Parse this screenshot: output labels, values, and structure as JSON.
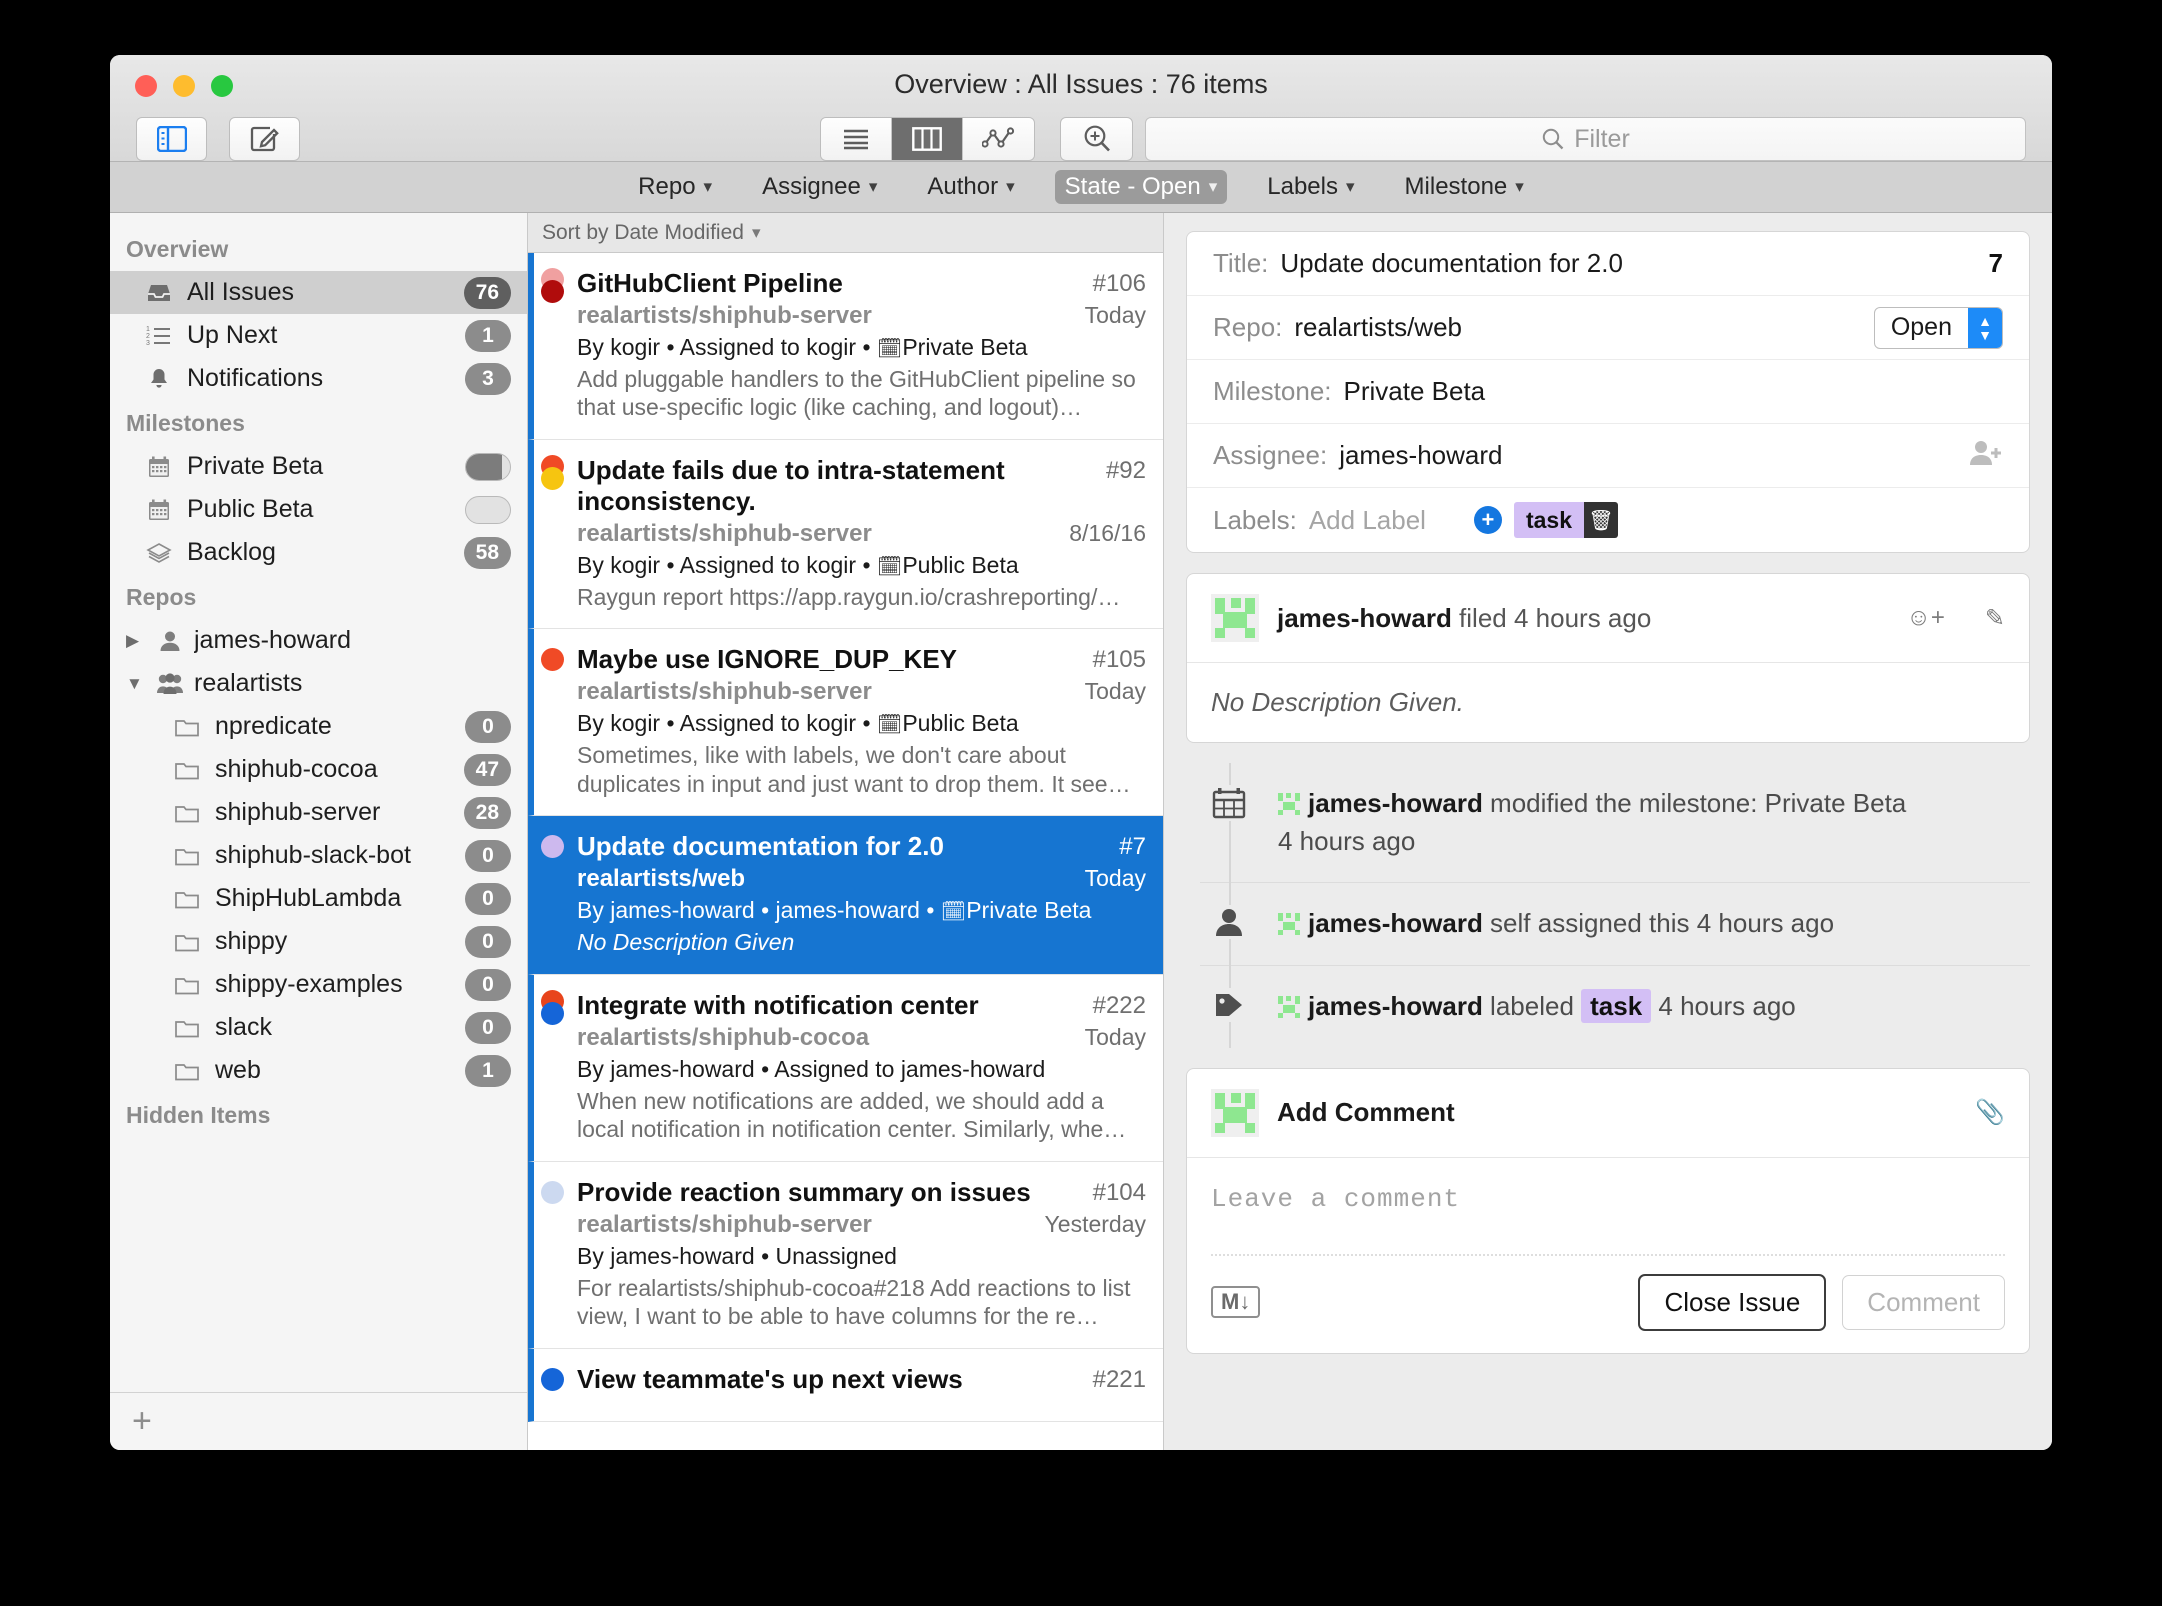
{
  "window": {
    "title": "Overview : All Issues : 76 items"
  },
  "toolbar": {
    "sidebar_toggle": "sidebar-toggle",
    "compose": "compose",
    "view_modes": [
      {
        "name": "list",
        "selected": false
      },
      {
        "name": "columns",
        "selected": true
      },
      {
        "name": "chart",
        "selected": false
      }
    ],
    "zoom": "zoom-in",
    "filter_placeholder": "Filter"
  },
  "filter_bar": [
    {
      "label": "Repo",
      "active": false
    },
    {
      "label": "Assignee",
      "active": false
    },
    {
      "label": "Author",
      "active": false
    },
    {
      "label": "State - Open",
      "active": true
    },
    {
      "label": "Labels",
      "active": false
    },
    {
      "label": "Milestone",
      "active": false
    }
  ],
  "sidebar": {
    "sections": [
      {
        "header": "Overview",
        "items": [
          {
            "label": "All Issues",
            "badge": "76",
            "icon": "inbox-icon",
            "selected": true,
            "badge_style": "dark"
          },
          {
            "label": "Up Next",
            "badge": "1",
            "icon": "numbered-list-icon",
            "selected": false,
            "badge_style": "gray"
          },
          {
            "label": "Notifications",
            "badge": "3",
            "icon": "bell-icon",
            "selected": false,
            "badge_style": "gray"
          }
        ]
      },
      {
        "header": "Milestones",
        "items": [
          {
            "label": "Private Beta",
            "icon": "calendar-icon",
            "progress": 82
          },
          {
            "label": "Public Beta",
            "icon": "calendar-icon",
            "progress": 0
          },
          {
            "label": "Backlog",
            "badge": "58",
            "icon": "stack-icon",
            "badge_style": "gray"
          }
        ]
      }
    ],
    "repos_header": "Repos",
    "owners": [
      {
        "label": "james-howard",
        "icon": "person-icon",
        "expanded": false,
        "repos": []
      },
      {
        "label": "realartists",
        "icon": "people-icon",
        "expanded": true,
        "repos": [
          {
            "label": "npredicate",
            "badge": "0"
          },
          {
            "label": "shiphub-cocoa",
            "badge": "47"
          },
          {
            "label": "shiphub-server",
            "badge": "28"
          },
          {
            "label": "shiphub-slack-bot",
            "badge": "0"
          },
          {
            "label": "ShipHubLambda",
            "badge": "0"
          },
          {
            "label": "shippy",
            "badge": "0"
          },
          {
            "label": "shippy-examples",
            "badge": "0"
          },
          {
            "label": "slack",
            "badge": "0"
          },
          {
            "label": "web",
            "badge": "1"
          }
        ]
      }
    ],
    "hidden_header": "Hidden Items",
    "add_label": "+"
  },
  "list": {
    "sort_label": "Sort by Date Modified",
    "issues": [
      {
        "title": "GitHubClient Pipeline",
        "number": "#106",
        "repo": "realartists/shiphub-server",
        "date": "Today",
        "meta": "By kogir • Assigned to kogir • ",
        "milestone": "Private Beta",
        "desc": "Add pluggable handlers to the GitHubClient pipeline so that use-specific logic (like caching, and logout)…",
        "desc_italic": false,
        "selected": false,
        "dot_top": "#f0a0a0",
        "dot_bottom": "#b00c0c"
      },
      {
        "title": "Update fails due to intra-statement inconsistency.",
        "number": "#92",
        "repo": "realartists/shiphub-server",
        "date": "8/16/16",
        "meta": "By kogir • Assigned to kogir • ",
        "milestone": "Public Beta",
        "desc": "Raygun report https://app.raygun.io/crashreporting/…",
        "desc_italic": false,
        "selected": false,
        "dot_top": "#f04a26",
        "dot_bottom": "#f6c510"
      },
      {
        "title": "Maybe use IGNORE_DUP_KEY",
        "number": "#105",
        "repo": "realartists/shiphub-server",
        "date": "Today",
        "meta": "By kogir • Assigned to kogir • ",
        "milestone": "Public Beta",
        "desc": "Sometimes, like with labels, we don't care about duplicates in input and just want to drop them. It see…",
        "desc_italic": false,
        "selected": false,
        "dot_top": "",
        "dot_bottom": "#f04a26"
      },
      {
        "title": "Update documentation for 2.0",
        "number": "#7",
        "repo": "realartists/web",
        "date": "Today",
        "meta": "By james-howard • james-howard • ",
        "milestone": "Private Beta",
        "desc": "No Description Given",
        "desc_italic": true,
        "selected": true,
        "dot_top": "",
        "dot_bottom": "#cdb9ee"
      },
      {
        "title": "Integrate with notification center",
        "number": "#222",
        "repo": "realartists/shiphub-cocoa",
        "date": "Today",
        "meta": "By james-howard • Assigned to james-howard",
        "milestone": "",
        "desc": "When new notifications are added, we should add a local notification in notification center. Similarly, whe…",
        "desc_italic": false,
        "selected": false,
        "dot_top": "#e8441c",
        "dot_bottom": "#1565d8"
      },
      {
        "title": "Provide reaction summary on issues",
        "number": "#104",
        "repo": "realartists/shiphub-server",
        "date": "Yesterday",
        "meta": "By james-howard • Unassigned",
        "milestone": "",
        "desc": "For realartists/shiphub-cocoa#218 Add reactions to list view, I want to be able to have columns for the re…",
        "desc_italic": false,
        "selected": false,
        "dot_top": "",
        "dot_bottom": "#ccd9f0"
      },
      {
        "title": "View teammate's up next views",
        "number": "#221",
        "repo": "",
        "date": "",
        "meta": "",
        "milestone": "",
        "desc": "",
        "desc_italic": false,
        "selected": false,
        "dot_top": "",
        "dot_bottom": "#1565d8"
      }
    ]
  },
  "detail": {
    "fields": {
      "title_label": "Title:",
      "title_value": "Update documentation for 2.0",
      "issue_number": "7",
      "repo_label": "Repo:",
      "repo_value": "realartists/web",
      "state_value": "Open",
      "milestone_label": "Milestone:",
      "milestone_value": "Private Beta",
      "assignee_label": "Assignee:",
      "assignee_value": "james-howard",
      "labels_label": "Labels:",
      "add_label_placeholder": "Add Label",
      "label_chip": "task"
    },
    "description_comment": {
      "author": "james-howard",
      "action": " filed 4 hours ago",
      "body": "No Description Given."
    },
    "events": [
      {
        "icon": "calendar-icon",
        "author": "james-howard",
        "text": " modified the milestone: Private Beta",
        "time": "4 hours ago",
        "chip": ""
      },
      {
        "icon": "person-icon",
        "author": "james-howard",
        "text": " self assigned this 4 hours ago",
        "time": "",
        "chip": ""
      },
      {
        "icon": "tag-icon",
        "author": "james-howard",
        "text": " labeled ",
        "time": " 4 hours ago",
        "chip": "task"
      }
    ],
    "add_comment": {
      "header": "Add Comment",
      "placeholder": "Leave a comment",
      "markdown_badge": "M↓",
      "close_button": "Close Issue",
      "comment_button": "Comment"
    }
  },
  "colors": {
    "selection_blue": "#1675d1",
    "accent_blue": "#1d8bf8",
    "label_purple": "#d3bff5",
    "avatar_green": "#8ee790"
  }
}
